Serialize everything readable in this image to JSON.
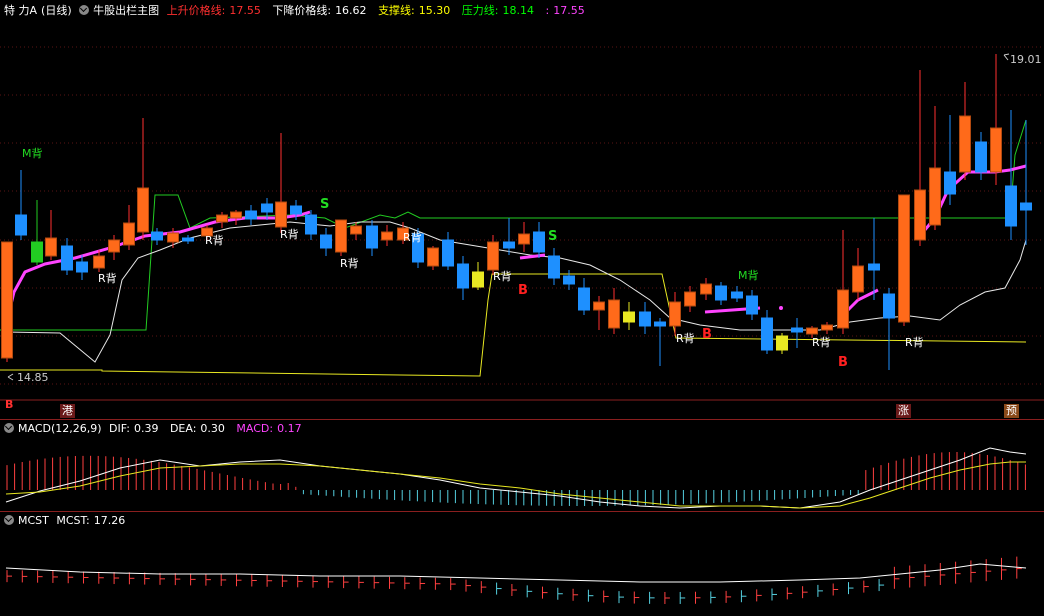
{
  "main_header": {
    "stock_name": "特 力A",
    "period": "(日线)",
    "indicator_name": "牛股出栏主图",
    "items": [
      {
        "label": "上升价格线:",
        "value": "17.55",
        "color": "#ff3030"
      },
      {
        "label": "下降价格线:",
        "value": "16.62",
        "color": "#ffffff"
      },
      {
        "label": "支撑线:",
        "value": "15.30",
        "color": "#ffff00"
      },
      {
        "label": "压力线:",
        "value": "18.14",
        "color": "#00ff00"
      },
      {
        "label": ":",
        "value": "17.55",
        "color": "#ff44ff"
      }
    ]
  },
  "macd_header": {
    "name": "MACD(12,26,9)",
    "items": [
      {
        "label": "DIF:",
        "value": "0.39",
        "color": "#ffffff"
      },
      {
        "label": "DEA:",
        "value": "0.30",
        "color": "#ffff00"
      },
      {
        "label": "MACD:",
        "value": "0.17",
        "color": "#ff44ff"
      }
    ]
  },
  "mcst_header": {
    "name": "MCST",
    "items": [
      {
        "label": "MCST:",
        "value": "17.26",
        "color": "#ffffff"
      }
    ]
  },
  "price_labels": {
    "high": "19.01",
    "low": "14.85"
  },
  "annotations": {
    "m_back_1": "M背",
    "m_back_2": "M背",
    "r_back": "R背",
    "s": "S",
    "b": "B"
  },
  "event_tags": [
    "港",
    "涨",
    "预"
  ],
  "left_marker": "B",
  "colors": {
    "up": "#ff6a1a",
    "down": "#1e90ff",
    "cyan": "#66e0ff",
    "pink": "#ff44ff",
    "yellow": "#ffff66",
    "green": "#22cc22",
    "grid": "#8a1f1f",
    "white": "#ffffff"
  }
}
